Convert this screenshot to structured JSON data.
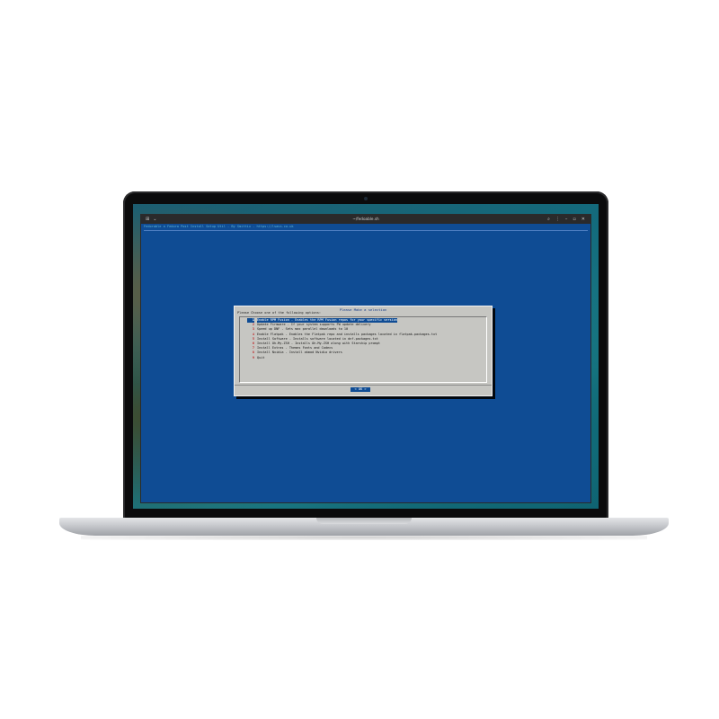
{
  "window": {
    "title": "~/fedoable.sh"
  },
  "terminal": {
    "backtitle": "Fedorable a Fedora Post Install Setup Util - By Smittix - https://lsass.co.uk"
  },
  "dialog": {
    "title": "Please Make a selection",
    "prompt": "Please Choose one of the following options:",
    "items": [
      {
        "tag": "1",
        "desc": "Enable RPM Fusion - Enables the RPM Fusion repos for your specific version",
        "selected": true
      },
      {
        "tag": "2",
        "desc": "Update Firmware - If your system supports FW update delivery",
        "selected": false
      },
      {
        "tag": "3",
        "desc": "Speed up DNF - Sets max parallel downloads to 10",
        "selected": false
      },
      {
        "tag": "4",
        "desc": "Enable Flatpak - Enables the Flatpak repo and installs packages located in flatpak-packages.txt",
        "selected": false
      },
      {
        "tag": "5",
        "desc": "Install Software - Installs software located in dnf-packages.txt",
        "selected": false
      },
      {
        "tag": "6",
        "desc": "Install Oh-My-ZSH - Installs Oh-My-ZSH along with Starship prompt",
        "selected": false
      },
      {
        "tag": "7",
        "desc": "Install Extras - Themes Fonts and Codecs",
        "selected": false
      },
      {
        "tag": "8",
        "desc": "Install Nvidia - Install akmod Nvidia drivers",
        "selected": false
      },
      {
        "tag": "9",
        "desc": "Quit",
        "selected": false
      }
    ],
    "ok_label": "< OK >"
  },
  "colors": {
    "terminal_bg": "#0f4c94",
    "dialog_bg": "#c6c6c2",
    "tag_color": "#c0282a",
    "title_color": "#1a3f8a"
  }
}
